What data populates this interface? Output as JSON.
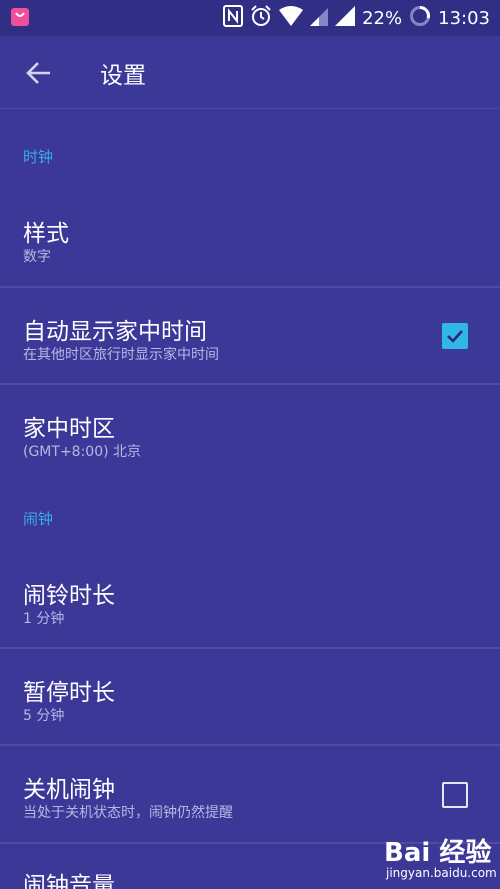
{
  "status": {
    "battery": "22%",
    "time": "13:03"
  },
  "toolbar": {
    "title": "设置"
  },
  "sections": {
    "clock": "时钟",
    "alarm": "闹钟"
  },
  "items": {
    "style": {
      "title": "样式",
      "subtitle": "数字"
    },
    "home_time": {
      "title": "自动显示家中时间",
      "subtitle": "在其他时区旅行时显示家中时间",
      "checked": true
    },
    "home_tz": {
      "title": "家中时区",
      "subtitle": "(GMT+8:00) 北京"
    },
    "ring_duration": {
      "title": "闹铃时长",
      "subtitle": "1 分钟"
    },
    "snooze": {
      "title": "暂停时长",
      "subtitle": "5 分钟"
    },
    "power_off_alarm": {
      "title": "关机闹钟",
      "subtitle": "当处于关机状态时，闹钟仍然提醒",
      "checked": false
    },
    "alarm_volume": {
      "title": "闹钟音量"
    }
  },
  "watermark": {
    "logo": "Bai 经验",
    "url": "jingyan.baidu.com"
  },
  "colors": {
    "background": "#3c3898",
    "statusbar": "#312e86",
    "accent": "#2fb8e6",
    "section_header": "#3aa8ee"
  }
}
